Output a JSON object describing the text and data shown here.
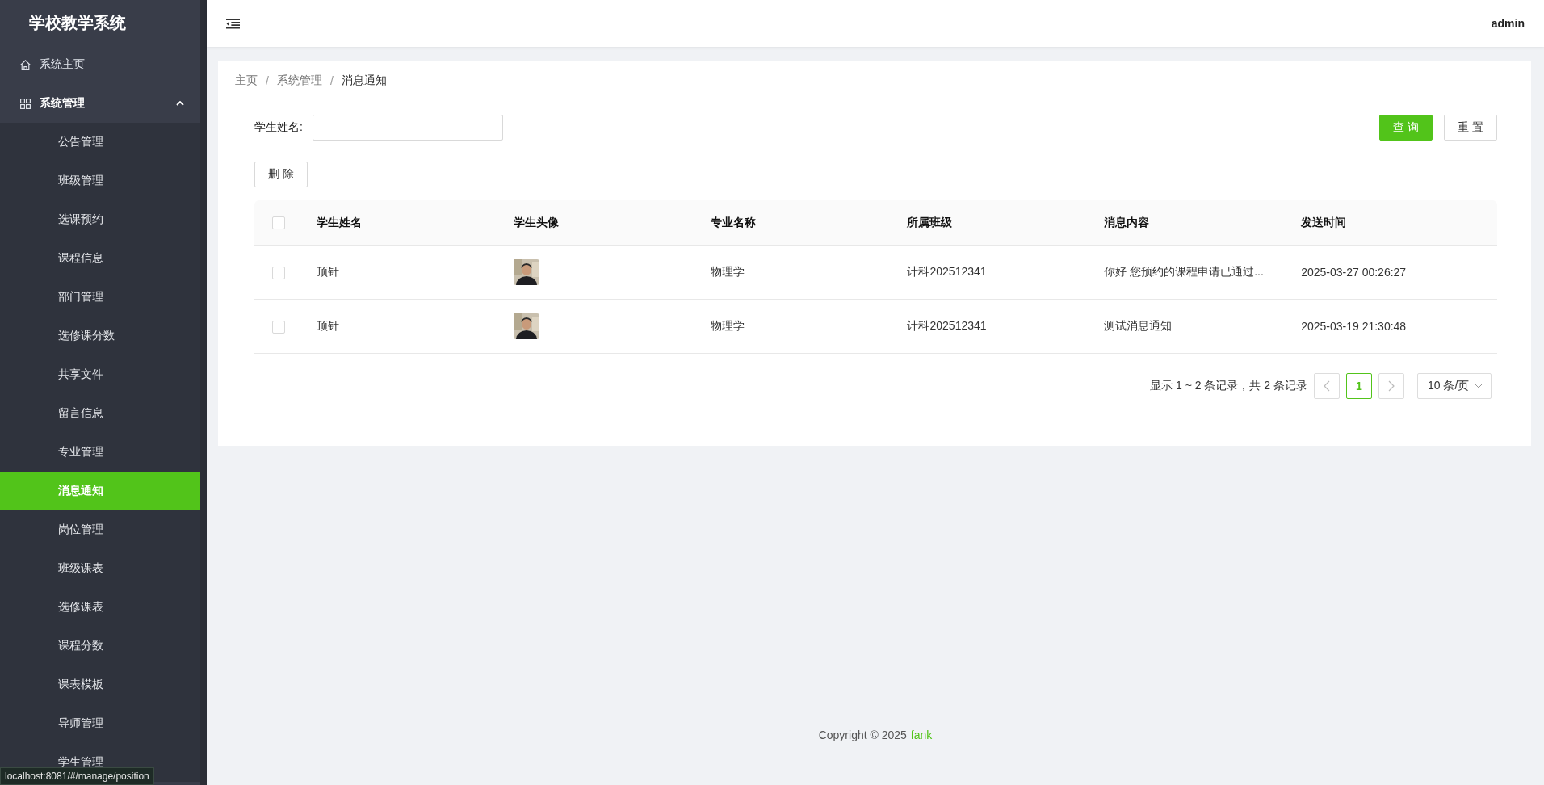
{
  "sidebar": {
    "title": "学校教学系统",
    "items": [
      {
        "label": "系统主页",
        "kind": "page"
      },
      {
        "label": "系统管理",
        "kind": "group",
        "expanded": true,
        "children": [
          {
            "label": "公告管理",
            "selected": false
          },
          {
            "label": "班级管理",
            "selected": false
          },
          {
            "label": "选课预约",
            "selected": false
          },
          {
            "label": "课程信息",
            "selected": false
          },
          {
            "label": "部门管理",
            "selected": false
          },
          {
            "label": "选修课分数",
            "selected": false
          },
          {
            "label": "共享文件",
            "selected": false
          },
          {
            "label": "留言信息",
            "selected": false
          },
          {
            "label": "专业管理",
            "selected": false
          },
          {
            "label": "消息通知",
            "selected": true
          },
          {
            "label": "岗位管理",
            "selected": false
          },
          {
            "label": "班级课表",
            "selected": false
          },
          {
            "label": "选修课表",
            "selected": false
          },
          {
            "label": "课程分数",
            "selected": false
          },
          {
            "label": "课表模板",
            "selected": false
          },
          {
            "label": "导师管理",
            "selected": false
          },
          {
            "label": "学生管理",
            "selected": false
          }
        ]
      }
    ]
  },
  "header": {
    "user": "admin"
  },
  "breadcrumb": {
    "separator": "/",
    "items": [
      "主页",
      "系统管理",
      "消息通知"
    ]
  },
  "search": {
    "label": "学生姓名:",
    "buttons": [
      {
        "label": "查 询",
        "kind": "primary"
      },
      {
        "label": "重 置",
        "kind": "default"
      }
    ]
  },
  "toolbar": {
    "buttons": [
      {
        "label": "删 除",
        "kind": "default"
      }
    ]
  },
  "table": {
    "all_checked": false,
    "columns": [
      "学生姓名",
      "学生头像",
      "专业名称",
      "所属班级",
      "消息内容",
      "发送时间"
    ],
    "rows": [
      {
        "checked": false,
        "cells": [
          {
            "kind": "text",
            "text": "顶针"
          },
          {
            "kind": "picture"
          },
          {
            "kind": "text",
            "text": "物理学"
          },
          {
            "kind": "text",
            "text": "计科202512341"
          },
          {
            "kind": "text",
            "text": "你好 您预约的课程申请已通过..."
          },
          {
            "kind": "text",
            "text": "2025-03-27 00:26:27"
          }
        ]
      },
      {
        "checked": false,
        "cells": [
          {
            "kind": "text",
            "text": "顶针"
          },
          {
            "kind": "picture"
          },
          {
            "kind": "text",
            "text": "物理学"
          },
          {
            "kind": "text",
            "text": "计科202512341"
          },
          {
            "kind": "text",
            "text": "测试消息通知"
          },
          {
            "kind": "text",
            "text": "2025-03-19 21:30:48"
          }
        ]
      }
    ]
  },
  "pagination": {
    "summary": "显示 1 ~ 2 条记录，共 2 条记录",
    "pages": [
      {
        "label": "1",
        "selected": true
      }
    ],
    "page_size": "10 条/页"
  },
  "footer": {
    "text": "Copyright © 2025",
    "link": "fank"
  },
  "status_bar": {
    "url": "localhost:8081/#/manage/position"
  }
}
